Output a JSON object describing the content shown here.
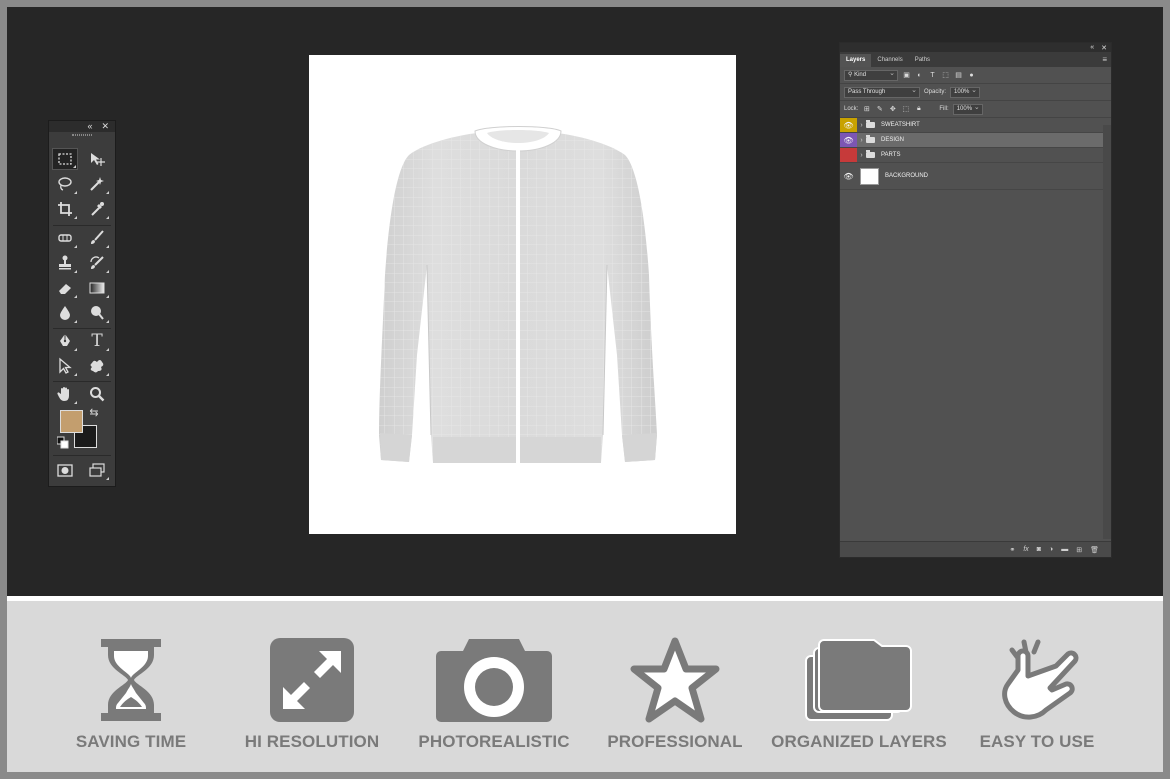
{
  "tools_panel": {
    "collapse_icon": "«",
    "close_icon": "✕",
    "tools": [
      {
        "name": "rect-marquee-icon",
        "glyph": ""
      },
      {
        "name": "move-icon",
        "glyph": ""
      },
      {
        "name": "lasso-icon",
        "glyph": ""
      },
      {
        "name": "magic-wand-icon",
        "glyph": ""
      },
      {
        "name": "crop-icon",
        "glyph": ""
      },
      {
        "name": "eyedropper-icon",
        "glyph": ""
      },
      {
        "name": "healing-brush-icon",
        "glyph": ""
      },
      {
        "name": "brush-icon",
        "glyph": ""
      },
      {
        "name": "clone-stamp-icon",
        "glyph": ""
      },
      {
        "name": "history-brush-icon",
        "glyph": ""
      },
      {
        "name": "eraser-icon",
        "glyph": ""
      },
      {
        "name": "gradient-icon",
        "glyph": ""
      },
      {
        "name": "blur-icon",
        "glyph": ""
      },
      {
        "name": "dodge-icon",
        "glyph": ""
      },
      {
        "name": "pen-icon",
        "glyph": ""
      },
      {
        "name": "type-icon",
        "glyph": "T"
      },
      {
        "name": "path-select-icon",
        "glyph": ""
      },
      {
        "name": "custom-shape-icon",
        "glyph": ""
      },
      {
        "name": "hand-icon",
        "glyph": ""
      },
      {
        "name": "zoom-icon",
        "glyph": ""
      }
    ],
    "foreground_color": "#c39e6e",
    "background_color": "#1b1b1b"
  },
  "layers_panel": {
    "collapse_icon": "«",
    "close_icon": "✕",
    "tabs": [
      "Layers",
      "Channels",
      "Paths"
    ],
    "filter_label": "Kind",
    "blend_mode": "Pass Through",
    "opacity_label": "Opacity:",
    "opacity_value": "100%",
    "lock_label": "Lock:",
    "fill_label": "Fill:",
    "fill_value": "100%",
    "layers": [
      {
        "name": "SWEATSHIRT",
        "color": "#c8a200"
      },
      {
        "name": "DESIGN",
        "color": "#7c56b3"
      },
      {
        "name": "PARTS",
        "color": "#c63a3a"
      },
      {
        "name": "BACKGROUND",
        "color": ""
      }
    ],
    "footer_icons": [
      "link-icon",
      "fx-icon",
      "mask-icon",
      "adjustment-icon",
      "group-icon",
      "new-layer-icon",
      "trash-icon"
    ]
  },
  "features": [
    {
      "label": "SAVING TIME",
      "icon": "hourglass-icon"
    },
    {
      "label": "HI RESOLUTION",
      "icon": "expand-icon"
    },
    {
      "label": "PHOTOREALISTIC",
      "icon": "camera-icon"
    },
    {
      "label": "PROFESSIONAL",
      "icon": "star-icon"
    },
    {
      "label": "ORGANIZED LAYERS",
      "icon": "layers-icon"
    },
    {
      "label": "EASY TO USE",
      "icon": "hand-tap-icon"
    }
  ],
  "colors": {
    "workspace": "#262626",
    "feature_icon": "#7a7a7a",
    "feature_band": "#d9d9d9"
  }
}
